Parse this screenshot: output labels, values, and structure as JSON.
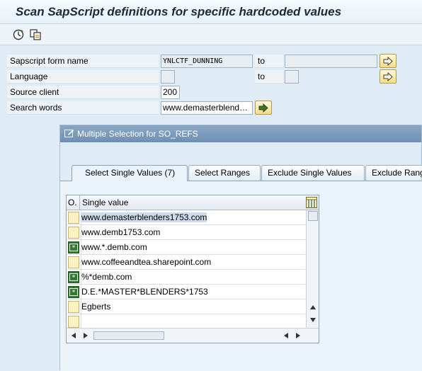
{
  "window": {
    "title": "Scan SapScript definitions for specific hardcoded values"
  },
  "toolbar": {
    "icons": [
      "execute-icon",
      "copy-variant-icon"
    ]
  },
  "form": {
    "fields": [
      {
        "label": "Sapscript form name",
        "value": "YNLCTF_DUNNING",
        "to_label": "to",
        "to_value": ""
      },
      {
        "label": "Language",
        "value": "",
        "to_label": "to",
        "to_value": ""
      },
      {
        "label": "Source client",
        "value": "200"
      },
      {
        "label": "Search words",
        "value": "www.demasterblend…"
      }
    ]
  },
  "dialog": {
    "title": "Multiple Selection for SO_REFS",
    "tabs": [
      {
        "label": "Select Single Values (7)"
      },
      {
        "label": "Select Ranges"
      },
      {
        "label": "Exclude Single Values"
      },
      {
        "label": "Exclude Rang"
      }
    ],
    "grid": {
      "col_option": "O.",
      "col_value": "Single value",
      "rows": [
        {
          "option": "none",
          "value": "www.demasterblenders1753.com",
          "selected": true
        },
        {
          "option": "none",
          "value": "www.demb1753.com"
        },
        {
          "option": "pattern",
          "value": "www.*.demb.com"
        },
        {
          "option": "none",
          "value": "www.coffeeandtea.sharepoint.com"
        },
        {
          "option": "pattern",
          "value": "%*demb.com"
        },
        {
          "option": "pattern",
          "value": "D.E.*MASTER*BLENDERS*1753"
        },
        {
          "option": "none",
          "value": "Egberts"
        },
        {
          "option": "none",
          "value": ""
        }
      ]
    }
  },
  "colors": {
    "title_bar": "#6f8fb3",
    "background": "#dfebf5",
    "select_button": "#f3dc8a",
    "pattern_option": "#2f7a2f"
  }
}
